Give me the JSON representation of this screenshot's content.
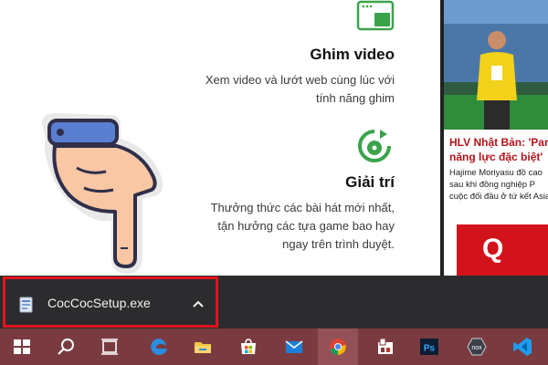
{
  "features": [
    {
      "title": "Ghim video",
      "desc_lines": [
        "Xem video và lướt web cùng lúc với",
        "tính năng ghim"
      ],
      "icon": "pin-video-icon"
    },
    {
      "title": "Giải trí",
      "desc_lines": [
        "Thưởng thức các bài hát mới nhất,",
        "tận hưởng các tựa game bao hay",
        "ngay trên trình duyệt."
      ],
      "icon": "entertainment-icon"
    }
  ],
  "news": {
    "headline_lines": [
      "HLV Nhật Bản: 'Park",
      "năng lực đặc biệt'"
    ],
    "summary_lines": [
      "Hajime Moriyasu đồ cao",
      "sau khi đồng nghiệp P",
      "cuộc đối đầu ở tứ kết Asian"
    ],
    "promo_text": "Q"
  },
  "download": {
    "file_name": "CocCocSetup.exe",
    "file_icon": "installer-file-icon",
    "menu_icon": "chevron-up-icon"
  },
  "taskbar": {
    "icons": [
      "windows-start-icon",
      "search-icon",
      "task-view-icon",
      "edge-icon",
      "file-explorer-icon",
      "microsoft-store-icon",
      "mail-icon",
      "chrome-icon",
      "pinned-app-icon",
      "photoshop-icon",
      "nox-icon",
      "vscode-icon"
    ],
    "ps_label": "Ps",
    "nox_label": "nox"
  },
  "colors": {
    "taskbar": "#7a3b40",
    "download_bar": "#2c2c2e",
    "highlight_border": "#e1141c",
    "accent_green": "#3aa34a",
    "headline_red": "#b4141b"
  }
}
